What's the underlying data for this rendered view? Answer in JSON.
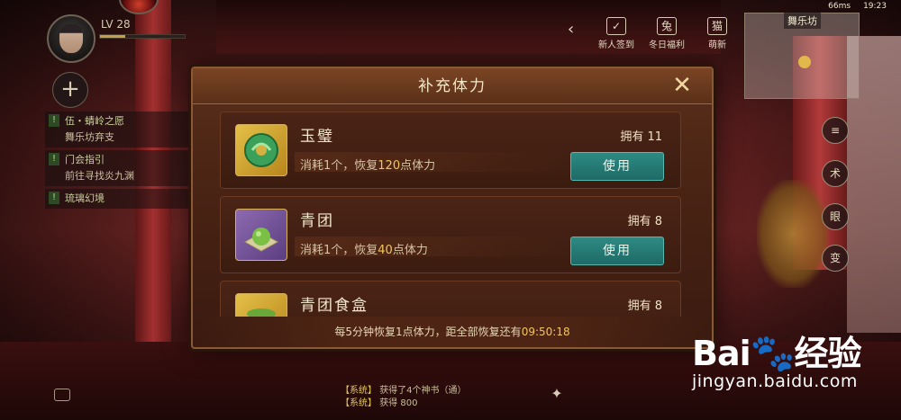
{
  "hud": {
    "level": "LV 28",
    "exp_fraction": 0.3,
    "plus": "+",
    "quests": [
      {
        "mark": "!",
        "title": "伍・蜻岭之愿",
        "sub": "舞乐坊弃支"
      },
      {
        "mark": "!",
        "title": "门会指引",
        "sub": "前往寻找炎九渊"
      },
      {
        "mark": "!",
        "title": "琉璃幻境",
        "sub": ""
      }
    ],
    "status": {
      "ping": "66ms",
      "time": "19:23"
    },
    "back_icon": "‹",
    "top_buttons": [
      {
        "icon": "✓",
        "label": "新人签到"
      },
      {
        "icon": "兔",
        "label": "冬日福利"
      },
      {
        "icon": "猫",
        "label": "萌新"
      }
    ],
    "minimap_name": "舞乐坊",
    "side_icons": [
      {
        "icon": "≡",
        "name": "menu"
      },
      {
        "icon": "术",
        "name": "skill"
      },
      {
        "icon": "眼",
        "name": "view"
      },
      {
        "icon": "变",
        "name": "transform"
      }
    ]
  },
  "modal": {
    "title": "补充体力",
    "close": "✕",
    "items": [
      {
        "name": "玉璧",
        "desc_prefix": "消耗1个，恢复",
        "desc_num": "120",
        "desc_suffix": "点体力",
        "owned": "拥有 11",
        "use_label": "使用",
        "icon": "jade-disc-icon",
        "icon_color": "#d9a93a"
      },
      {
        "name": "青团",
        "desc_prefix": "消耗1个，恢复",
        "desc_num": "40",
        "desc_suffix": "点体力",
        "owned": "拥有 8",
        "use_label": "使用",
        "icon": "green-dumpling-icon",
        "icon_color": "#7a5aa0"
      },
      {
        "name": "青团食盒",
        "owned": "拥有 8",
        "icon": "food-box-icon",
        "icon_color": "#d9a93a"
      }
    ],
    "footer_prefix": "每5分钟恢复1点体力，距全部恢复还有",
    "footer_timer": "09:50:18"
  },
  "chat": {
    "lines": [
      {
        "tag": "【系统】",
        "text": "获得了4个神书（通）"
      },
      {
        "tag": "【系统】",
        "text": "获得 800"
      }
    ]
  },
  "watermark": {
    "logo": "Bai",
    "logo2": "经验",
    "sub": "jingyan.baidu.com"
  }
}
